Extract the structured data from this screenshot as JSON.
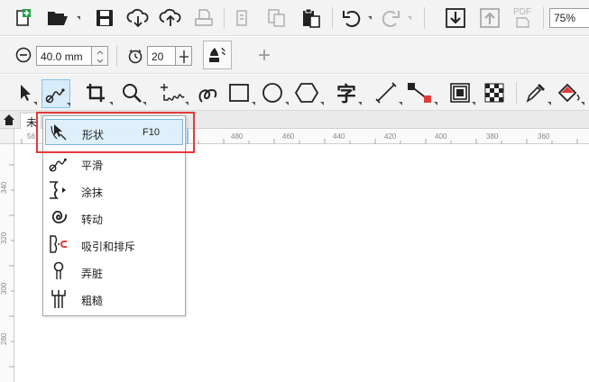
{
  "toolbar": {
    "icons": [
      "new-document-icon",
      "open-folder-icon",
      "save-icon",
      "download-cloud-icon",
      "upload-cloud-icon",
      "print-icon",
      "cut-icon",
      "copy-icon",
      "paste-icon",
      "undo-icon",
      "redo-icon",
      "import-icon",
      "export-icon",
      "pdf-icon"
    ],
    "pdf_label": "PDF",
    "zoom_value": "75%"
  },
  "property_bar": {
    "nudge_value": "40.0 mm",
    "duplicate_value": "20",
    "add_label": "+"
  },
  "toolbox": {
    "text_tool_label": "字",
    "active_tool": "shape-edit-flyout"
  },
  "document_tab": {
    "label": "未"
  },
  "rulers": {
    "horizontal_labels": [
      "56",
      "480",
      "460",
      "440",
      "420",
      "400",
      "380",
      "360"
    ],
    "vertical_labels": [
      "340",
      "320",
      "300",
      "280"
    ]
  },
  "flyout_menu": {
    "items": [
      {
        "icon": "shape-tool-icon",
        "label": "形状",
        "shortcut": "F10",
        "selected": true
      },
      {
        "icon": "smooth-tool-icon",
        "label": "平滑",
        "shortcut": ""
      },
      {
        "icon": "smear-tool-icon",
        "label": "涂抹",
        "shortcut": ""
      },
      {
        "icon": "twirl-tool-icon",
        "label": "转动",
        "shortcut": ""
      },
      {
        "icon": "attract-repel-tool-icon",
        "label": "吸引和排斥",
        "shortcut": ""
      },
      {
        "icon": "smudge-tool-icon",
        "label": "弄脏",
        "shortcut": ""
      },
      {
        "icon": "roughen-tool-icon",
        "label": "粗糙",
        "shortcut": ""
      }
    ]
  },
  "colors": {
    "highlight": "#e23b3b",
    "selection_fill": "#dff0fb",
    "selection_border": "#7fb5dd",
    "ruler_highlight": "#33a3dc"
  }
}
